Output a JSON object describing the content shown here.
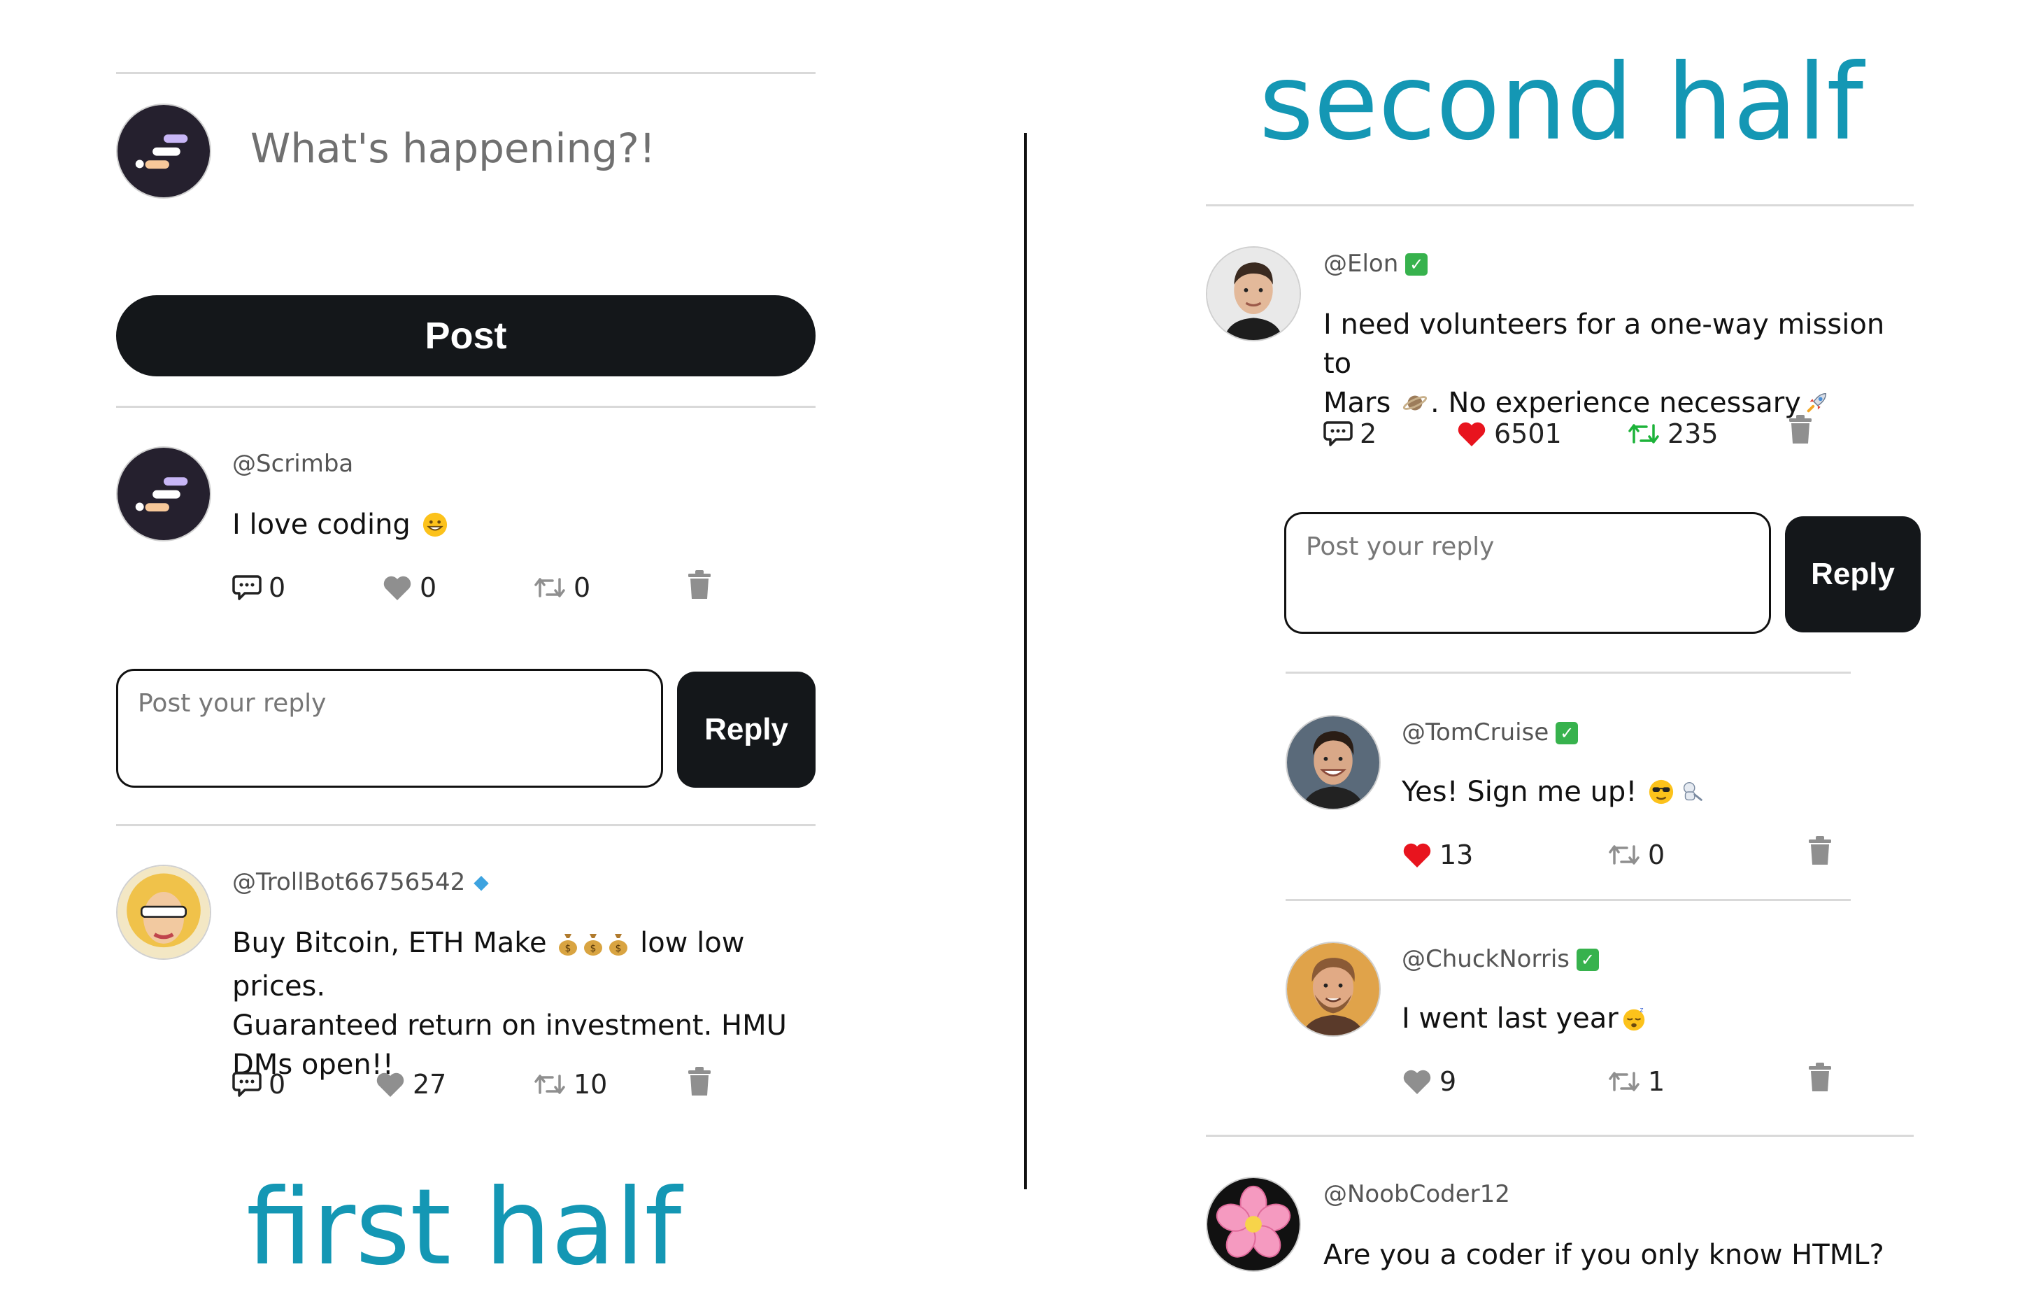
{
  "captions": {
    "first": "first half",
    "second": "second half"
  },
  "composer": {
    "placeholder": "What's happening?!",
    "post_label": "Post"
  },
  "reply": {
    "placeholder": "Post your reply",
    "button_label": "Reply"
  },
  "left_tweets": [
    {
      "handle": "@Scrimba",
      "text": "I love coding",
      "replies": "0",
      "likes": "0",
      "retweets": "0"
    },
    {
      "handle": "@TrollBot66756542",
      "text_line1": "Buy Bitcoin, ETH Make",
      "text_line1b": "low low prices.",
      "text_line2": "Guaranteed return on investment. HMU",
      "text_line3": "DMs open!!",
      "replies": "0",
      "likes": "27",
      "retweets": "10"
    }
  ],
  "main_tweet": {
    "handle": "@Elon",
    "text_line1": "I need volunteers for a one-way mission to",
    "text_line2a": "Mars",
    "text_line2b": ". No experience necessary",
    "replies": "2",
    "likes": "6501",
    "retweets": "235"
  },
  "replies_list": [
    {
      "handle": "@TomCruise",
      "text": "Yes! Sign me up!",
      "likes": "13",
      "retweets": "0"
    },
    {
      "handle": "@ChuckNorris",
      "text": "I went last year",
      "likes": "9",
      "retweets": "1"
    }
  ],
  "bottom_tweet": {
    "handle": "@NoobCoder12",
    "text": "Are you a coder if you only know HTML?"
  },
  "colors": {
    "accent": "#1497b4",
    "liked": "#e8141e",
    "retweeted": "#1db33a",
    "button_dark": "#14171a",
    "verified": "#37b24d"
  },
  "icons": [
    "scrimba-logo-icon",
    "comment-icon",
    "heart-icon",
    "retweet-icon",
    "trash-icon",
    "verified-icon",
    "diamond-icon"
  ]
}
